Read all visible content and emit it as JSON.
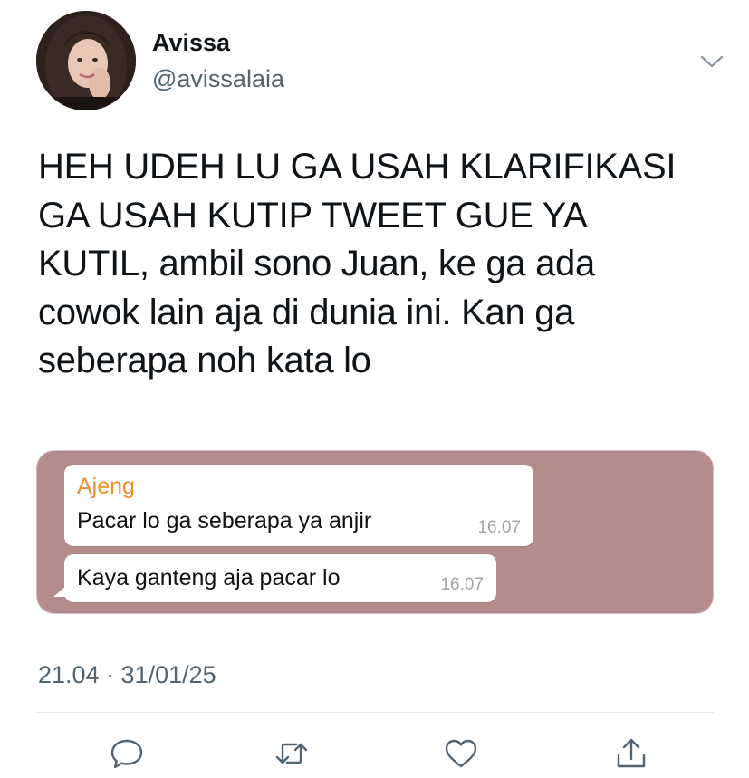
{
  "user": {
    "display_name": "Avissa",
    "handle": "@avissalaia"
  },
  "tweet": {
    "text_lines": [
      "HEH UDEH LU GA USAH KLARIFIKASI",
      "GA USAH KUTIP TWEET GUE YA",
      "KUTIL, ambil sono Juan, ke ga ada",
      "cowok lain aja di dunia ini. Kan ga",
      "seberapa noh kata lo"
    ],
    "timestamp": "21.04 · 31/01/25"
  },
  "media": {
    "background_color": "#b48c8b",
    "messages": [
      {
        "sender": "Ajeng",
        "text": "Pacar lo ga seberapa ya anjir",
        "time": "16.07"
      },
      {
        "text": "Kaya ganteng aja pacar lo",
        "time": "16.07"
      }
    ]
  },
  "actions": {
    "reply_icon": "speech-bubble-icon",
    "retweet_icon": "retweet-icon",
    "like_icon": "heart-icon",
    "share_icon": "share-upload-icon"
  },
  "colors": {
    "text_primary": "#0f1419",
    "text_secondary": "#536471",
    "sender_name": "#e9902a",
    "icon_gray": "#536471"
  }
}
